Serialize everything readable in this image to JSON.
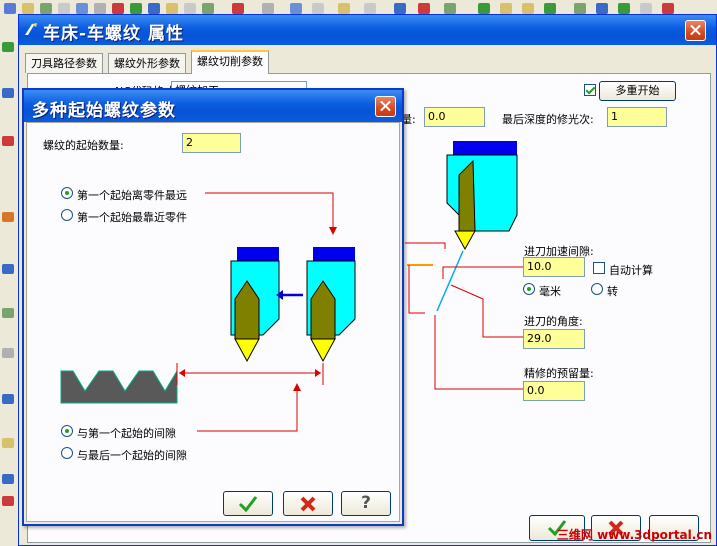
{
  "main_window": {
    "title": "车床-车螺纹 属性",
    "tabs": [
      {
        "label": "刀具路径参数",
        "active": false
      },
      {
        "label": "螺纹外形参数",
        "active": false
      },
      {
        "label": "螺纹切削参数",
        "active": true
      }
    ],
    "params": {
      "hidden_label_partial": "NC代码格式:",
      "hidden_select_partial": "螺纹加工",
      "depth_label_partial": "量:",
      "depth_value": "0.0",
      "final_pass_label": "最后深度的修光次:",
      "final_pass_value": "1",
      "multi_start_checked": true,
      "multi_start_button": "多重开始",
      "accel_clearance_label": "进刀加速间隙:",
      "accel_clearance_value": "10.0",
      "auto_calc_label": "自动计算",
      "auto_calc_checked": false,
      "unit_mm_label": "毫米",
      "unit_rev_label": "转",
      "unit_selected": "毫米",
      "infeed_angle_label": "进刀的角度:",
      "infeed_angle_value": "29.0",
      "finish_allowance_label": "精修的预留量:",
      "finish_allowance_value": "0.0"
    }
  },
  "dialog": {
    "title": "多种起始螺纹参数",
    "start_count_label": "螺纹的起始数量:",
    "start_count_value": "2",
    "order_options": [
      {
        "label": "第一个起始离零件最远",
        "selected": true
      },
      {
        "label": "第一个起始最靠近零件",
        "selected": false
      }
    ],
    "gap_options": [
      {
        "label": "与第一个起始的间隙",
        "selected": true
      },
      {
        "label": "与最后一个起始的间隙",
        "selected": false
      }
    ],
    "buttons": {
      "ok": "✔",
      "cancel": "✖",
      "help": "?"
    }
  },
  "watermark": "三维网 www.3dportal.cn",
  "colors": {
    "title_bar": "#0a5ce0",
    "field_bg": "#ffff99",
    "tool_body": "#00ffff",
    "tool_top": "#0000ee",
    "insert": "#808000",
    "insert_tip": "#ffff00",
    "leader_line": "#dd0000",
    "arrow_blue": "#0000cc"
  }
}
